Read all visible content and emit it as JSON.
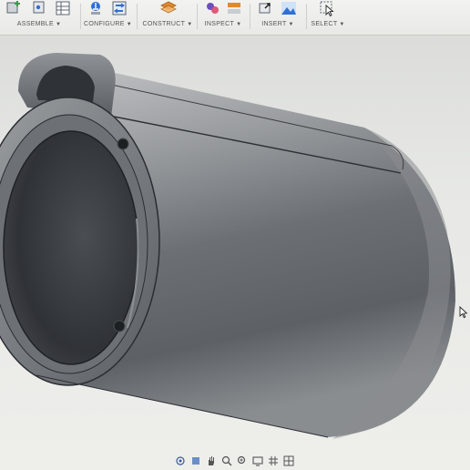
{
  "toolbar": {
    "groups": [
      {
        "label": "ASSEMBLE"
      },
      {
        "label": "CONFIGURE"
      },
      {
        "label": "CONSTRUCT"
      },
      {
        "label": "INSPECT"
      },
      {
        "label": "INSERT"
      },
      {
        "label": "SELECT"
      }
    ],
    "caret": "▼"
  },
  "icons": {
    "assemble": [
      "new-component-icon",
      "joint-icon",
      "table-icon"
    ],
    "configure": [
      "parameter-icon",
      "configure-icon"
    ],
    "construct": [
      "offset-plane-icon"
    ],
    "inspect": [
      "measure-icon",
      "section-analysis-icon"
    ],
    "insert": [
      "insert-derive-icon",
      "insert-mesh-icon"
    ],
    "select": [
      "select-arrow-icon"
    ]
  },
  "colors": {
    "accent_blue": "#2f6fd6",
    "green": "#2e9f4f",
    "orange": "#e08a2c",
    "part_dark": "#4a4d52",
    "part_mid": "#7e8186",
    "part_light": "#b9bbbd"
  },
  "navigation_bar": [
    "orbit-icon",
    "pan-icon",
    "hand-icon",
    "zoom-icon",
    "fit-icon",
    "display-settings-icon",
    "grid-icon",
    "viewports-icon"
  ]
}
